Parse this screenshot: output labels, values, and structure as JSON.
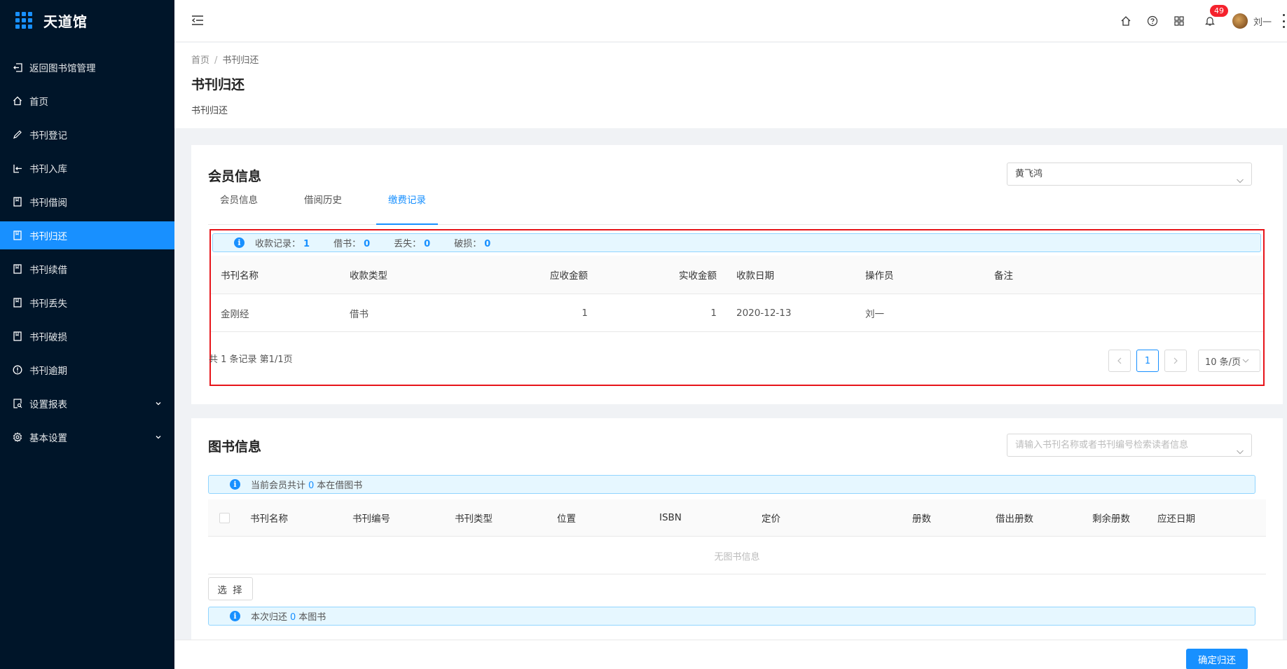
{
  "app": {
    "name": "天道馆"
  },
  "sidebar": {
    "items": [
      {
        "label": "返回图书馆管理",
        "icon": "return-icon"
      },
      {
        "label": "首页",
        "icon": "home-icon"
      },
      {
        "label": "书刊登记",
        "icon": "edit-icon"
      },
      {
        "label": "书刊入库",
        "icon": "login-icon"
      },
      {
        "label": "书刊借阅",
        "icon": "book-icon"
      },
      {
        "label": "书刊归还",
        "icon": "book-icon",
        "active": true
      },
      {
        "label": "书刊续借",
        "icon": "book-icon"
      },
      {
        "label": "书刊丢失",
        "icon": "book-icon"
      },
      {
        "label": "书刊破损",
        "icon": "book-icon"
      },
      {
        "label": "书刊逾期",
        "icon": "warning-icon"
      },
      {
        "label": "设置报表",
        "icon": "report-icon"
      },
      {
        "label": "基本设置",
        "icon": "gear-icon"
      }
    ]
  },
  "header": {
    "notification_count": "49",
    "username": "刘一"
  },
  "breadcrumb": {
    "home": "首页",
    "current": "书刊归还"
  },
  "page": {
    "title": "书刊归还",
    "subtitle": "书刊归还"
  },
  "member": {
    "title": "会员信息",
    "selected_member": "黄飞鸿",
    "tabs": [
      "会员信息",
      "借阅历史",
      "缴费记录"
    ],
    "active_tab": 2,
    "summary": {
      "records_label": "收款记录：",
      "records_value": "1",
      "borrow_label": "借书：",
      "borrow_value": "0",
      "lost_label": "丢失：",
      "lost_value": "0",
      "damaged_label": "破损：",
      "damaged_value": "0"
    },
    "table": {
      "columns": [
        "书刊名称",
        "收款类型",
        "应收金额",
        "实收金额",
        "收款日期",
        "操作员",
        "备注"
      ],
      "rows": [
        [
          "金刚经",
          "借书",
          "1",
          "1",
          "2020-12-13",
          "刘一",
          ""
        ]
      ]
    },
    "pagination": {
      "total_text": "共 1 条记录 第1/1页",
      "current_page": "1",
      "page_size": "10 条/页"
    }
  },
  "books": {
    "title": "图书信息",
    "search_placeholder": "请输入书刊名称或者书刊编号检索读者信息",
    "info_prefix": "当前会员共计",
    "info_count": "0",
    "info_suffix": "本在借图书",
    "columns": [
      "书刊名称",
      "书刊编号",
      "书刊类型",
      "位置",
      "ISBN",
      "定价",
      "册数",
      "借出册数",
      "剩余册数",
      "应还日期"
    ],
    "empty_text": "无图书信息",
    "select_button": "选 择",
    "return_prefix": "本次归还",
    "return_count": "0",
    "return_suffix": "本图书"
  },
  "footer": {
    "confirm_button": "确定归还"
  },
  "colors": {
    "primary": "#1890ff",
    "sidebar_bg": "#001529",
    "highlight_border": "#e7141a",
    "badge": "#f5222d"
  }
}
